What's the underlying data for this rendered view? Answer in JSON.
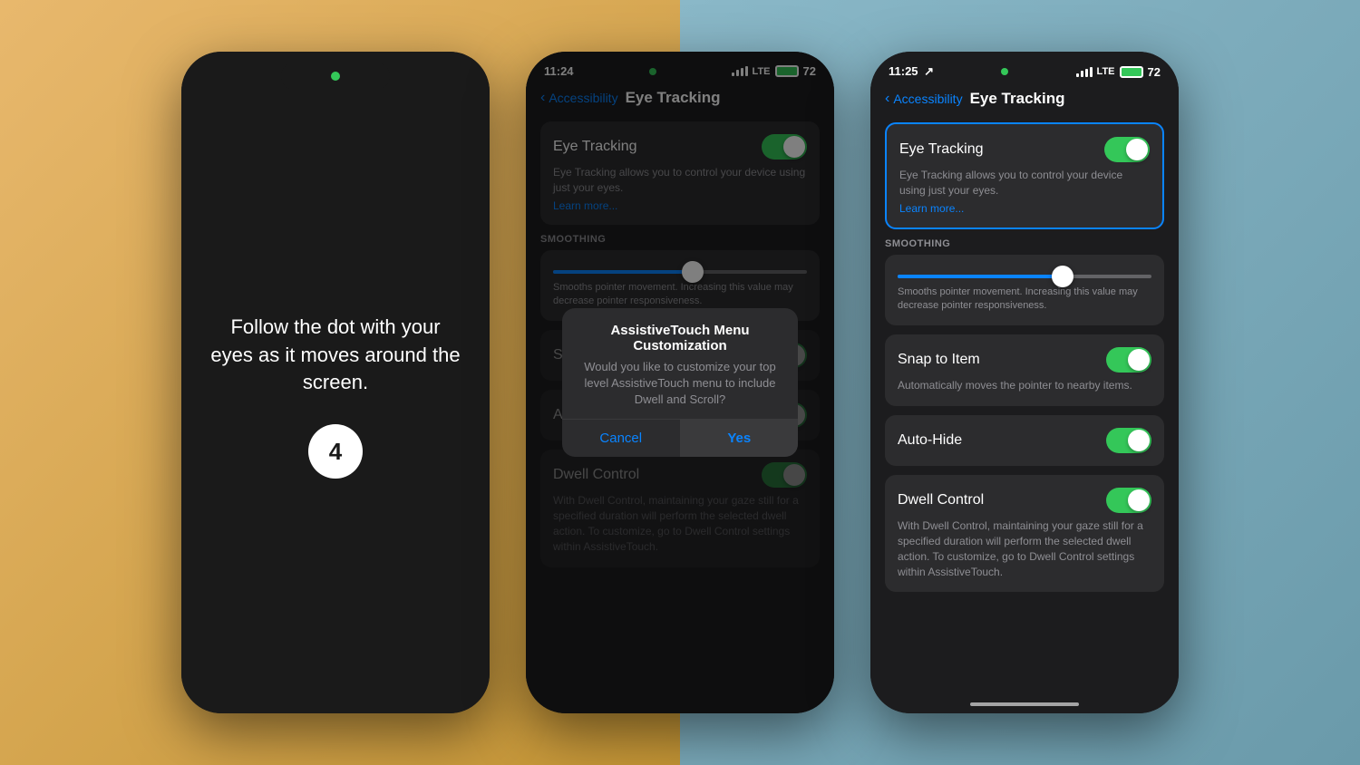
{
  "background": {
    "left_gradient_start": "#e8b86d",
    "left_gradient_end": "#c49535",
    "right_gradient_start": "#8ab8c8",
    "right_gradient_end": "#6a9aaa"
  },
  "phone1": {
    "instruction_text": "Follow the dot with your eyes as it moves around the screen.",
    "step_number": "4",
    "dot_color": "#34c759"
  },
  "phone2": {
    "status_bar": {
      "time": "11:24",
      "signal": "LTE",
      "battery": "72"
    },
    "nav": {
      "back_label": "Accessibility",
      "title": "Eye Tracking"
    },
    "eye_tracking_section": {
      "label": "Eye Tracking",
      "desc": "Eye Tracking allows you to control your device using just your eyes.",
      "learn_more": "Learn more...",
      "toggle_on": true
    },
    "smoothing_section": {
      "label": "SMOOTHING",
      "desc": "Smooths pointer movement. Increasing this value may decrease pointer responsiveness."
    },
    "snap_label": "Snap to",
    "auto_label": "Auto",
    "dwell_section": {
      "label": "Dwell Control",
      "desc": "With Dwell Control, maintaining your gaze still for a specified duration will perform the selected dwell action. To customize, go to Dwell Control settings within AssistiveTouch.",
      "toggle_on": true
    },
    "modal": {
      "title": "AssistiveTouch Menu Customization",
      "message": "Would you like to customize your top level AssistiveTouch menu to include Dwell and Scroll?",
      "cancel_label": "Cancel",
      "yes_label": "Yes"
    }
  },
  "phone3": {
    "status_bar": {
      "time": "11:25",
      "signal": "LTE",
      "battery": "72"
    },
    "nav": {
      "back_label": "Accessibility",
      "title": "Eye Tracking"
    },
    "eye_tracking_section": {
      "label": "Eye Tracking",
      "desc": "Eye Tracking allows you to control your device using just your eyes.",
      "learn_more": "Learn more...",
      "toggle_on": true
    },
    "smoothing_section": {
      "label": "SMOOTHING",
      "desc": "Smooths pointer movement. Increasing this value may decrease pointer responsiveness."
    },
    "snap_section": {
      "label": "Snap to Item",
      "desc": "Automatically moves the pointer to nearby items.",
      "toggle_on": true
    },
    "auto_hide_section": {
      "label": "Auto-Hide",
      "desc": "",
      "toggle_on": true
    },
    "dwell_section": {
      "label": "Dwell Control",
      "desc": "With Dwell Control, maintaining your gaze still for a specified duration will perform the selected dwell action. To customize, go to Dwell Control settings within AssistiveTouch.",
      "toggle_on": true
    }
  }
}
